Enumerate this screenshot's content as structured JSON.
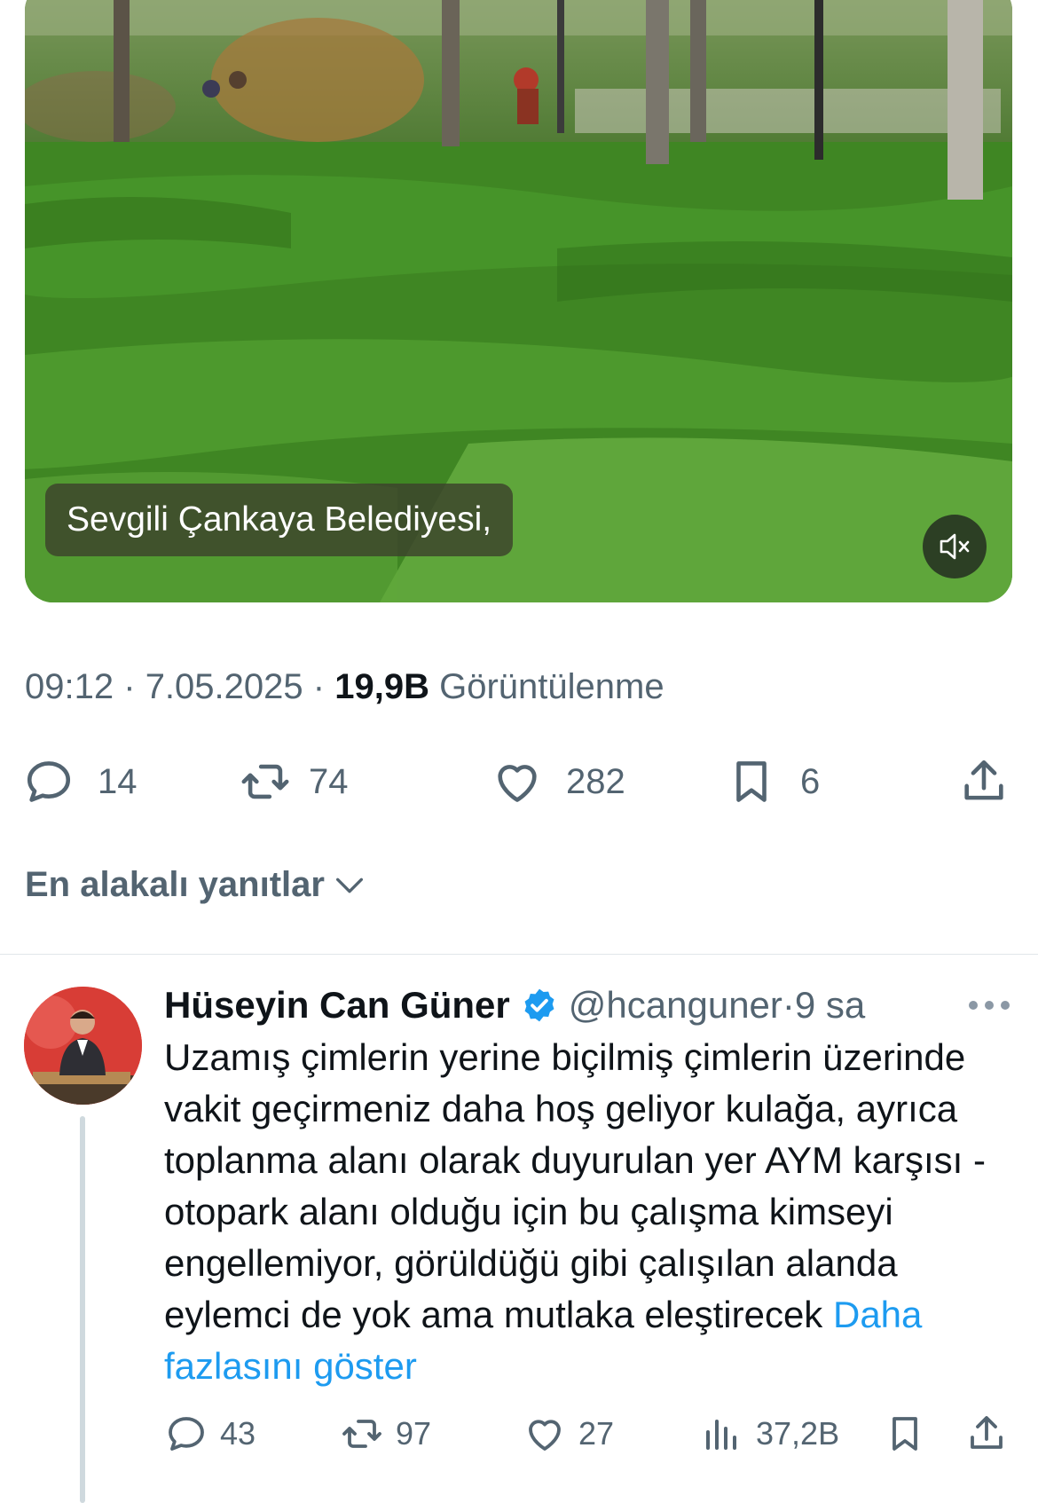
{
  "video": {
    "caption": "Sevgili Çankaya Belediyesi,",
    "mute_icon": "speaker-muted-icon"
  },
  "tweet": {
    "time": "09:12",
    "date": "7.05.2025",
    "separator": "·",
    "views_count": "19,9B",
    "views_label": "Görüntülenme",
    "replies": "14",
    "retweets": "74",
    "likes": "282",
    "bookmarks": "6"
  },
  "replies_section": {
    "sort_label": "En alakalı yanıtlar",
    "sort_icon": "chevron-down-icon"
  },
  "reply": {
    "name": "Hüseyin Can Güner",
    "handle": "@hcanguner",
    "separator": "·",
    "time": "9 sa",
    "verified": true,
    "text": "Uzamış çimlerin yerine biçilmiş çimlerin üzerinde vakit geçirmeniz daha hoş geliyor kulağa, ayrıca toplanma alanı olarak duyurulan yer AYM karşısı - otopark alanı olduğu için bu çalışma kimseyi engellemiyor, görüldüğü gibi çalışılan alanda eylemci de yok ama mutlaka eleştirecek",
    "show_more": "Daha fazlasını göster",
    "replies": "43",
    "retweets": "97",
    "likes": "27",
    "views": "37,2B"
  },
  "colors": {
    "text": "#0f1419",
    "secondary": "#536471",
    "link": "#1d9bf0",
    "verified": "#1d9bf0"
  }
}
